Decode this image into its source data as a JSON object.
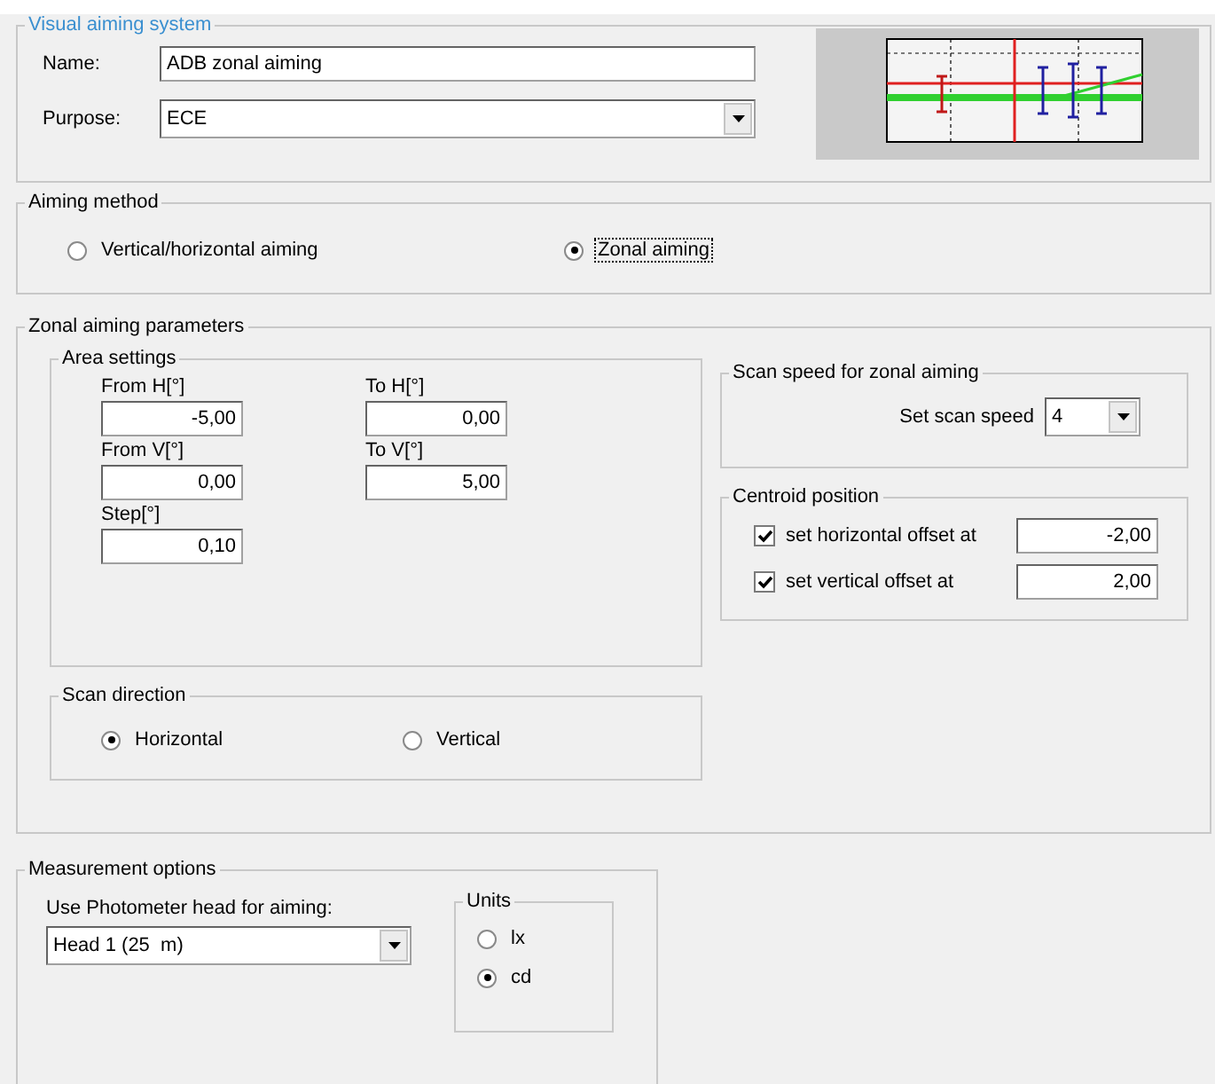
{
  "visual_aiming_system": {
    "title": "Visual aiming system",
    "name_label": "Name:",
    "name_value": "ADB zonal aiming",
    "purpose_label": "Purpose:",
    "purpose_value": "ECE"
  },
  "aiming_method": {
    "title": "Aiming method",
    "options": [
      {
        "label": "Vertical/horizontal aiming",
        "selected": false,
        "focused": false
      },
      {
        "label": "Zonal aiming",
        "selected": true,
        "focused": true
      }
    ]
  },
  "zonal_aiming_parameters": {
    "title": "Zonal aiming parameters",
    "area_settings": {
      "title": "Area settings",
      "fields": [
        {
          "label": "From H[°]",
          "value": "-5,00"
        },
        {
          "label": "To H[°]",
          "value": "0,00"
        },
        {
          "label": "From V[°]",
          "value": "0,00"
        },
        {
          "label": "To V[°]",
          "value": "5,00"
        },
        {
          "label": "Step[°]",
          "value": "0,10"
        }
      ]
    },
    "scan_direction": {
      "title": "Scan direction",
      "options": [
        {
          "label": "Horizontal",
          "selected": true
        },
        {
          "label": "Vertical",
          "selected": false
        }
      ]
    },
    "scan_speed": {
      "title": "Scan speed for zonal aiming",
      "label": "Set scan speed",
      "value": "4"
    },
    "centroid_position": {
      "title": "Centroid position",
      "offsets": [
        {
          "label": "set horizontal offset at",
          "checked": true,
          "value": "-2,00"
        },
        {
          "label": "set vertical offset at",
          "checked": true,
          "value": "2,00"
        }
      ]
    }
  },
  "measurement_options": {
    "title": "Measurement options",
    "head_label": "Use Photometer head for aiming:",
    "head_value": "Head 1 (25  m)",
    "units": {
      "title": "Units",
      "options": [
        {
          "label": "lx",
          "selected": false
        },
        {
          "label": "cd",
          "selected": true
        }
      ]
    }
  }
}
